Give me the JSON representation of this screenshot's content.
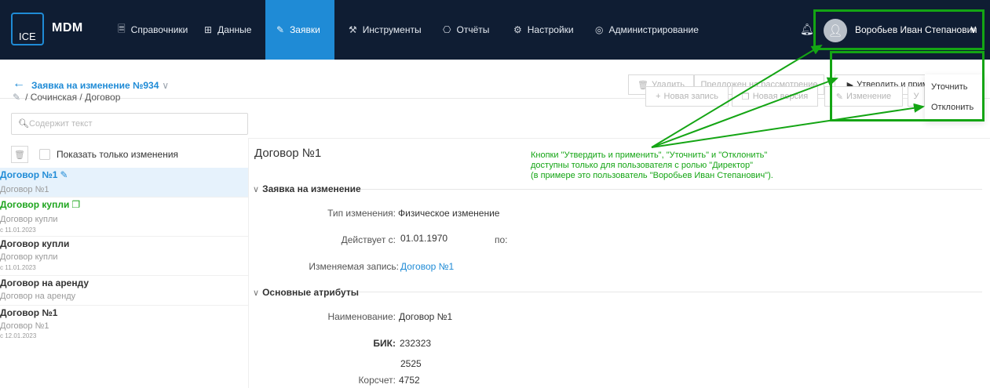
{
  "app": {
    "logo_text": "ICE",
    "brand": "MDM"
  },
  "nav": {
    "items": [
      {
        "label": "Справочники",
        "icon": "book-icon",
        "glyph": "🗏"
      },
      {
        "label": "Данные",
        "icon": "table-icon",
        "glyph": "⊞"
      },
      {
        "label": "Заявки",
        "icon": "edit-icon",
        "glyph": "✎"
      },
      {
        "label": "Инструменты",
        "icon": "tools-icon",
        "glyph": "⚒"
      },
      {
        "label": "Отчёты",
        "icon": "report-icon",
        "glyph": "⎔"
      },
      {
        "label": "Настройки",
        "icon": "gear-icon",
        "glyph": "⚙"
      },
      {
        "label": "Администрирование",
        "icon": "shield-icon",
        "glyph": "◎"
      }
    ],
    "active_index": 2
  },
  "user": {
    "name": "Воробьев Иван Степанович",
    "chevron": "∨"
  },
  "request": {
    "title": "Заявка на изменение №934",
    "chevron": "∨"
  },
  "actions": {
    "delete": "Удалить",
    "review": "Предложен на рассмотрение",
    "approve": "Утвердить и применить",
    "more": "···",
    "menu": [
      "Уточнить",
      "Отклонить"
    ]
  },
  "toolbar": {
    "new_record": "Новая запись",
    "new_version": "Новая версия",
    "change": "Изменение",
    "partial": "У"
  },
  "breadcrumb": "/ Сочинская / Договор",
  "search": {
    "placeholder": "Содержит текст"
  },
  "filter": {
    "show_changes": "Показать только изменения"
  },
  "list": [
    {
      "title": "Договор №1",
      "sub": "Договор №1",
      "date": "",
      "style": "blue",
      "marker": "pencil"
    },
    {
      "title": "Договор купли",
      "sub": "Договор купли",
      "date": "с 11.01.2023",
      "style": "green",
      "marker": "copy"
    },
    {
      "title": "Договор купли",
      "sub": "Договор купли",
      "date": "с 11.01.2023",
      "style": "normal",
      "marker": ""
    },
    {
      "title": "Договор на аренду",
      "sub": "Договор на аренду",
      "date": "",
      "style": "normal",
      "marker": ""
    },
    {
      "title": "Договор №1",
      "sub": "Договор №1",
      "date": "с 12.01.2023",
      "style": "normal",
      "marker": ""
    }
  ],
  "document": {
    "title": "Договор №1",
    "section_request": "Заявка на изменение",
    "change_type_label": "Тип изменения:",
    "change_type": "Физическое изменение",
    "valid_from_label": "Действует с:",
    "valid_from": "01.01.1970",
    "valid_to_label": "по:",
    "record_label": "Изменяемая запись:",
    "record_link": "Договор №1",
    "section_attrs": "Основные атрибуты",
    "name_label": "Наименование:",
    "name_value": "Договор №1",
    "bik_label": "БИК:",
    "bik_value": "232323",
    "extra_value": "2525",
    "korr_label": "Корсчет:",
    "korr_value": "4752"
  },
  "annotation": [
    "Кнопки \"Утвердить и применить\", \"Уточнить\" и \"Отклонить\"",
    "доступны только для пользователя с ролью \"Директор\"",
    "(в примере это пользователь \"Воробьев Иван Степанович\")."
  ],
  "colors": {
    "nav_bg": "#0f1d33",
    "accent": "#1f8bd6",
    "highlight": "#14a514"
  }
}
